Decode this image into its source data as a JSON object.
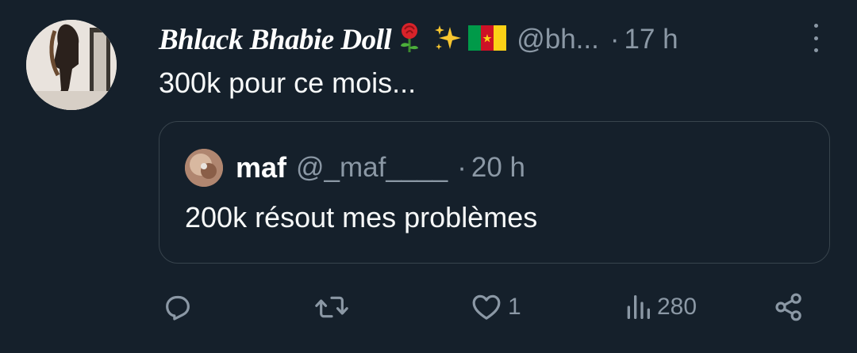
{
  "tweet": {
    "display_name": "Bhlack Bhabie Doll",
    "handle": "@bh...",
    "dot": "·",
    "time": "17 h",
    "text": "300k pour ce mois..."
  },
  "quote": {
    "name": "maf",
    "handle": "@_maf____",
    "dot": "·",
    "time": "20 h",
    "text": "200k résout mes problèmes"
  },
  "actions": {
    "reply": {
      "icon": "reply-icon",
      "count": ""
    },
    "retweet": {
      "icon": "retweet-icon",
      "count": ""
    },
    "like": {
      "icon": "heart-icon",
      "count": "1"
    },
    "views": {
      "icon": "views-icon",
      "count": "280"
    },
    "share": {
      "icon": "share-icon"
    }
  },
  "colors": {
    "background": "#15202b",
    "secondary_text": "#8b98a5",
    "border": "#38444d"
  }
}
